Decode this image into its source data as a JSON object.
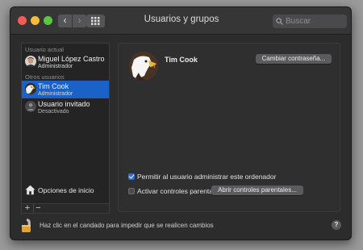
{
  "window": {
    "title": "Usuarios y grupos"
  },
  "toolbar": {
    "back_glyph": "‹",
    "forward_glyph": "›"
  },
  "search": {
    "placeholder": "Buscar"
  },
  "sidebar": {
    "current_user_label": "Usuario actual",
    "current_user": {
      "name": "Miguel López Castro",
      "role": "Administrador"
    },
    "other_users_label": "Otros usuarios",
    "other_users": [
      {
        "name": "Tim Cook",
        "role": "Administrador",
        "selected": true
      },
      {
        "name": "Usuario invitado",
        "role": "Desactivado",
        "selected": false
      }
    ],
    "login_options_label": "Opciones de inicio",
    "add_glyph": "+",
    "remove_glyph": "−"
  },
  "main": {
    "user_name": "Tim Cook",
    "change_password_label": "Cambiar contraseña...",
    "allow_admin_label": "Permitir al usuario administrar este ordenador",
    "allow_admin_checked": true,
    "parental_controls_label": "Activar controles parentales",
    "parental_controls_checked": false,
    "open_parental_label": "Abrir controles parentales..."
  },
  "footer": {
    "lock_text": "Haz clic en el candado para impedir que se realicen cambios",
    "help_glyph": "?"
  }
}
